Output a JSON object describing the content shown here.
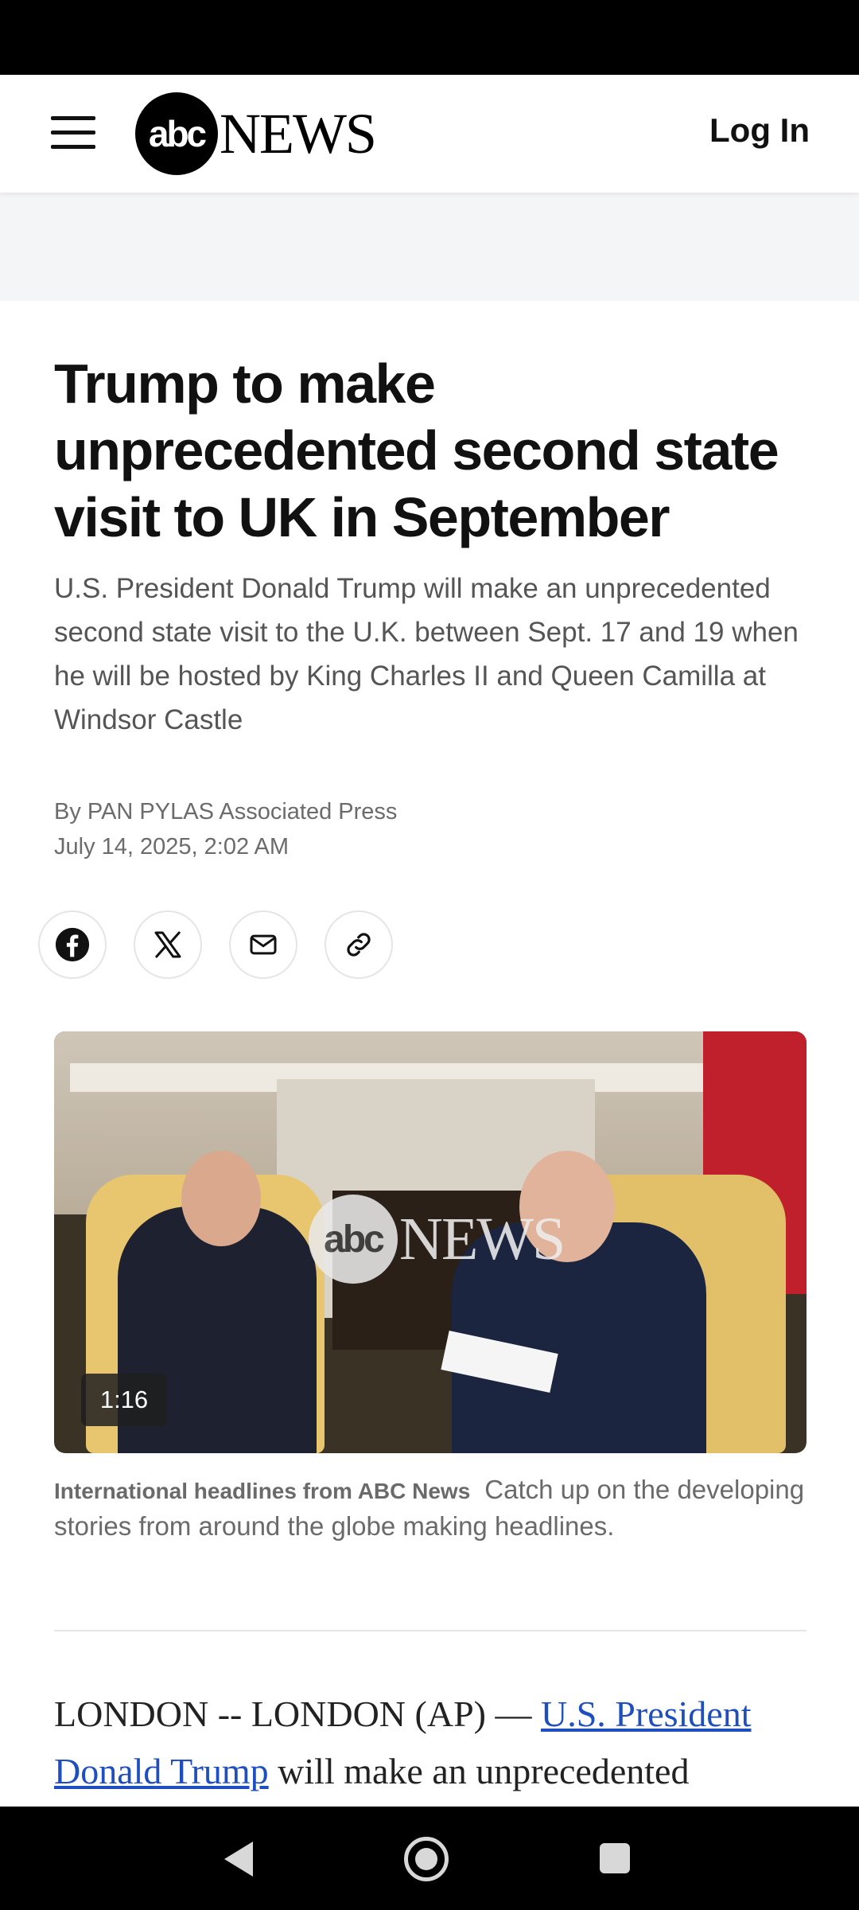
{
  "header": {
    "logo_abc": "abc",
    "logo_news": "NEWS",
    "login_label": "Log In"
  },
  "article": {
    "headline": "Trump to make unprecedented second state visit to UK in September",
    "dek": "U.S. President Donald Trump will make an unprecedented second state visit to the U.K. between Sept. 17 and 19 when he will be hosted by King Charles II and Queen Camilla at Windsor Castle",
    "byline": "By PAN PYLAS Associated Press",
    "date": "July 14, 2025, 2:02 AM"
  },
  "share": {
    "icons": [
      "facebook-icon",
      "x-icon",
      "email-icon",
      "link-icon"
    ]
  },
  "video": {
    "duration": "1:16",
    "watermark_abc": "abc",
    "watermark_news": "NEWS",
    "caption_title": "International headlines from ABC News",
    "caption_text": "Catch up on the developing stories from around the globe making headlines."
  },
  "body": {
    "lead": "LONDON -- LONDON (AP) — ",
    "link_text": "U.S. President Donald Trump",
    "rest": " will make an unprecedented"
  },
  "colors": {
    "link": "#1f4fbf",
    "dek": "#555555",
    "byline": "#6b6b6b"
  }
}
